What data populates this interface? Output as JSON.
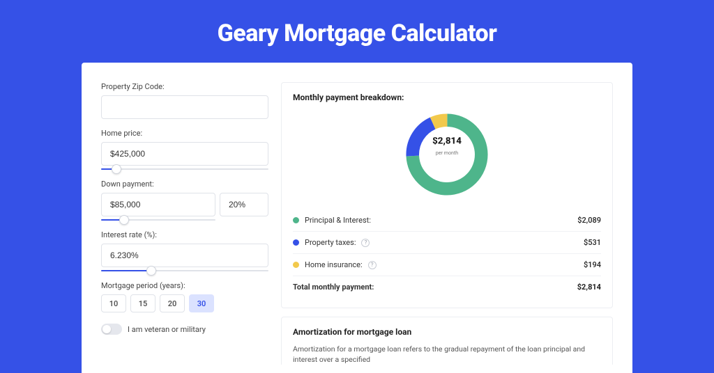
{
  "title": "Geary Mortgage Calculator",
  "form": {
    "zip_label": "Property Zip Code:",
    "zip_value": "",
    "price_label": "Home price:",
    "price_value": "$425,000",
    "price_slider_pct": 9,
    "down_label": "Down payment:",
    "down_value": "$85,000",
    "down_pct_value": "20%",
    "down_slider_pct": 20,
    "rate_label": "Interest rate (%):",
    "rate_value": "6.230%",
    "rate_slider_pct": 30,
    "period_label": "Mortgage period (years):",
    "periods": [
      "10",
      "15",
      "20",
      "30"
    ],
    "period_active_index": 3,
    "veteran_label": "I am veteran or military"
  },
  "breakdown": {
    "title": "Monthly payment breakdown:",
    "center_amount": "$2,814",
    "center_sub": "per month",
    "items": [
      {
        "label": "Principal & Interest:",
        "value": "$2,089",
        "color": "#4eb58b",
        "has_info": false
      },
      {
        "label": "Property taxes:",
        "value": "$531",
        "color": "#3551e7",
        "has_info": true
      },
      {
        "label": "Home insurance:",
        "value": "$194",
        "color": "#f2c94c",
        "has_info": true
      }
    ],
    "total_label": "Total monthly payment:",
    "total_value": "$2,814"
  },
  "amort": {
    "title": "Amortization for mortgage loan",
    "body": "Amortization for a mortgage loan refers to the gradual repayment of the loan principal and interest over a specified"
  },
  "chart_data": {
    "type": "pie",
    "title": "Monthly payment breakdown",
    "series": [
      {
        "name": "Principal & Interest",
        "value": 2089,
        "color": "#4eb58b"
      },
      {
        "name": "Property taxes",
        "value": 531,
        "color": "#3551e7"
      },
      {
        "name": "Home insurance",
        "value": 194,
        "color": "#f2c94c"
      }
    ],
    "total": 2814,
    "center_label": "$2,814 per month"
  }
}
